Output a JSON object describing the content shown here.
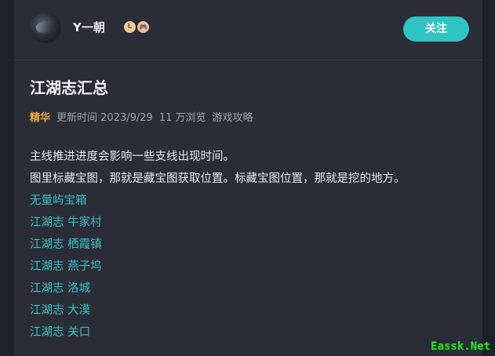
{
  "author": {
    "name": "Y一朝",
    "level_badge": "L",
    "game_badge": "🎮"
  },
  "follow_label": "关注",
  "post": {
    "title": "江湖志汇总",
    "tag": "精华",
    "updated": "更新时间 2023/9/29",
    "views": "11 万浏览",
    "category": "游戏攻略",
    "paragraphs": [
      "主线推进进度会影响一些支线出现时间。",
      "图里标藏宝图，那就是藏宝图获取位置。标藏宝图位置，那就是挖的地方。"
    ],
    "links": [
      "无量屿宝箱",
      "江湖志 牛家村",
      "江湖志 栖霞镇",
      "江湖志 燕子坞",
      "江湖志 洛城",
      "江湖志 大漠",
      "江湖志 关口"
    ]
  },
  "watermark": "Eassk.Net"
}
